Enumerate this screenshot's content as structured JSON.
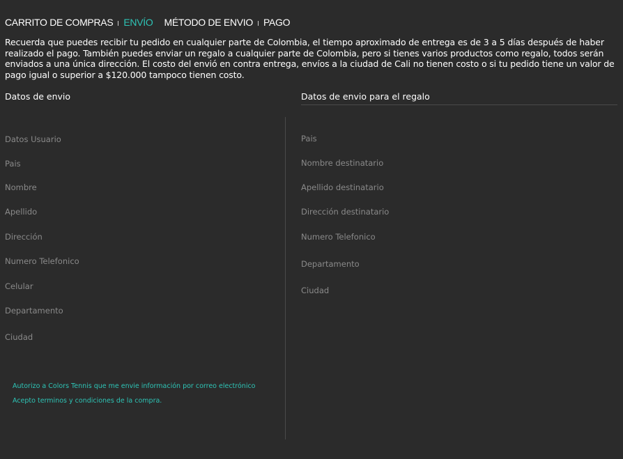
{
  "steps": {
    "cart": "CARRITO DE COMPRAS",
    "shipping": "ENVÍO",
    "method": "MÉTODO DE ENVIO",
    "payment": "PAGO"
  },
  "intro": "Recuerda que puedes recibir tu pedido en cualquier parte de Colombia, el tiempo aproximado de entrega es de 3 a 5 días después de haber realizado el pago.  También puedes enviar un regalo a cualquier parte de Colombia, pero si tienes varios productos como regalo, todos serán enviados a una única dirección. El costo del envió en contra entrega, envíos a la ciudad de Cali no tienen costo o si tu pedido tiene un valor de pago igual o superior a $120.000 tampoco tienen costo.",
  "shipping": {
    "title": "Datos de envio",
    "fields": {
      "user_data": "Datos Usuario",
      "country": "Pais",
      "name": "Nombre",
      "lastname": "Apellido",
      "address": "Dirección",
      "phone": "Numero Telefonico",
      "mobile": "Celular",
      "department": "Departamento",
      "city": "Ciudad"
    }
  },
  "gift": {
    "title": "Datos de envio para el regalo",
    "fields": {
      "country": "Pais",
      "recipient_name": "Nombre destinatario",
      "recipient_lastname": "Apellido destinatario",
      "recipient_address": "Dirección destinatario",
      "phone": "Numero Telefonico",
      "department": "Departamento",
      "city": "Ciudad"
    }
  },
  "consents": {
    "email": "Autorizo a Colors Tennis  que me envie información por correo electrónico",
    "terms": "Acepto terminos y condiciones de la compra."
  }
}
